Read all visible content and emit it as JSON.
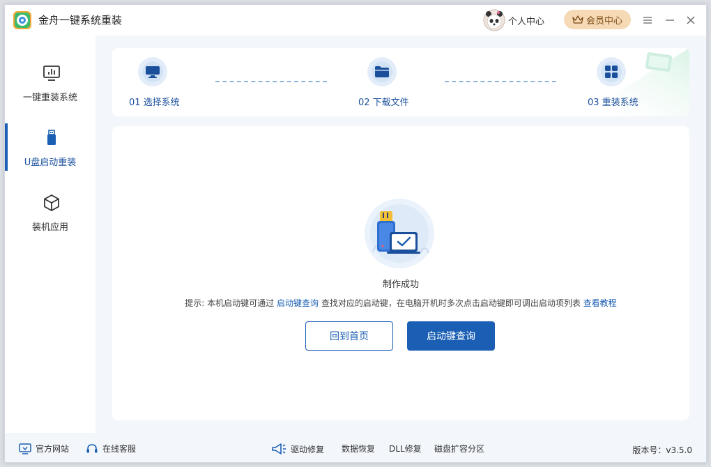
{
  "window": {
    "title": "金舟一键系统重装",
    "user_center": "个人中心",
    "vip_center": "会员中心"
  },
  "sidebar": {
    "items": [
      {
        "label": "一键重装系统",
        "icon": "monitor-chart-icon"
      },
      {
        "label": "U盘启动重装",
        "icon": "usb-drive-icon"
      },
      {
        "label": "装机应用",
        "icon": "cube-icon"
      }
    ]
  },
  "steps": [
    {
      "label": "01 选择系统",
      "icon": "monitor-icon"
    },
    {
      "label": "02 下载文件",
      "icon": "folder-icon"
    },
    {
      "label": "03 重装系统",
      "icon": "windows-icon"
    }
  ],
  "main": {
    "status": "制作成功",
    "hint_prefix": "提示: 本机启动键可通过",
    "hint_link1": "启动键查询",
    "hint_middle": "查找对应的启动键，在电脑开机时多次点击启动键即可调出启动项列表",
    "hint_link2": "查看教程",
    "btn_home": "回到首页",
    "btn_query": "启动键查询"
  },
  "footer": {
    "official_site": "官方网站",
    "online_service": "在线客服",
    "driver_repair": "驱动修复",
    "data_recovery": "数据恢复",
    "dll_repair": "DLL修复",
    "disk_partition": "磁盘扩容分区",
    "version": "版本号：v3.5.0"
  },
  "colors": {
    "accent": "#1a5fb4",
    "vip_bg": "#f6d9b5",
    "step_text": "#1a4f9c"
  }
}
